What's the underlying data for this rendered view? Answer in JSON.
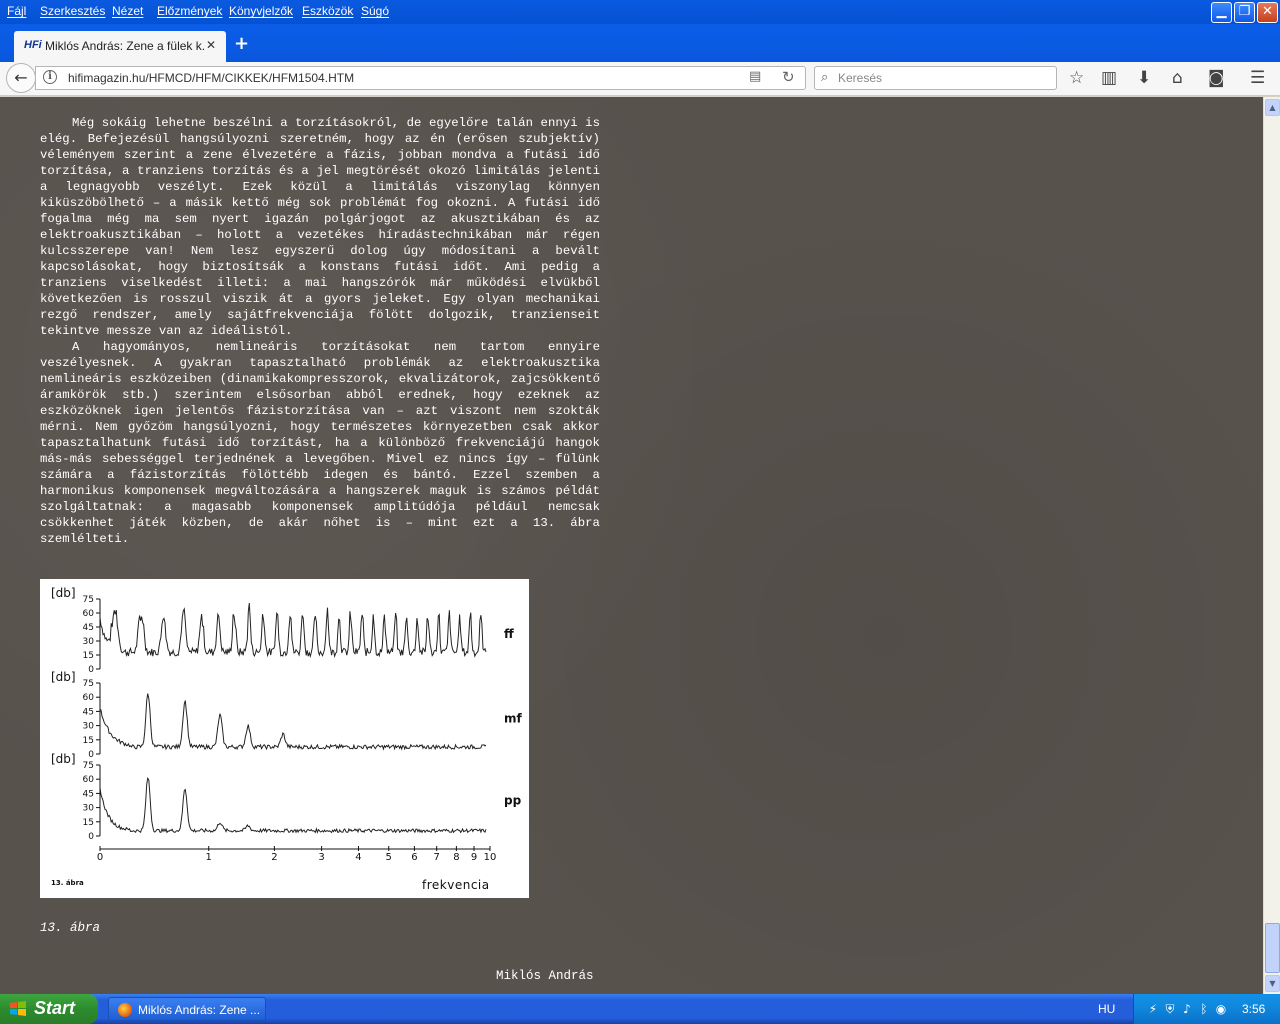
{
  "menubar": {
    "items": [
      "Fájl",
      "Szerkesztés",
      "Nézet",
      "Előzmények",
      "Könyvjelzők",
      "Eszközök",
      "Súgó"
    ]
  },
  "tab": {
    "favicon": "HFi",
    "title": "Miklós András: Zene a fülek k...",
    "close": "✕",
    "newtab": "+"
  },
  "navbar": {
    "url": "hifimagazin.hu/HFMCD/HFM/CIKKEK/HFM1504.HTM",
    "search_placeholder": "Keresés"
  },
  "article": {
    "paragraphs": [
      "Még sokáig lehetne beszélni a torzításokról, de egyelőre talán ennyi is elég. Befejezésül hangsúlyozni szeretném, hogy az én (erősen szubjektív) véleményem szerint a zene élvezetére a fázis, jobban mondva a futási idő torzítása, a tranziens torzítás és a jel megtörését okozó limitálás jelenti a legnagyobb veszélyt. Ezek közül a limitálás viszonylag könnyen kiküszöbölhető – a másik kettő még sok problémát fog okozni. A futási idő fogalma még ma sem nyert igazán polgárjogot az akusztikában és az elektroakusztikában – holott a vezetékes híradástechnikában már régen kulcsszerepe van! Nem lesz egyszerű dolog úgy módosítani a bevált kapcsolásokat, hogy biztosítsák a konstans futási időt. Ami pedig a tranziens viselkedést illeti: a mai hangszórók már működési elvükből következően is rosszul viszik át a gyors jeleket. Egy olyan mechanikai rezgő rendszer, amely sajátfrekvenciája fölött dolgozik, tranzienseit tekintve messze van az ideálistól.",
      "A hagyományos, nemlineáris torzításokat nem tartom ennyire veszélyesnek. A gyakran tapasztalható problémák az elektroakusztika nemlineáris eszközeiben (dinamikakompresszorok, ekvalizátorok, zajcsökkentő áramkörök stb.) szerintem elsősorban abból erednek, hogy ezeknek az eszközöknek igen jelentős fázistorzítása van – azt viszont nem szokták mérni. Nem győzöm hangsúlyozni, hogy természetes környezetben csak akkor tapasztalhatunk futási idő torzítást, ha a különböző frekvenciájú hangok más-más sebességgel terjednének a levegőben. Mivel ez nincs így – fülünk számára a fázistorzítás fölöttébb idegen és bántó. Ezzel szemben a harmonikus komponensek megváltozására a hangszerek maguk is számos példát szolgáltatnak: a magasabb komponensek amplitúdója például nemcsak csökkenhet játék közben, de akár nőhet is – mint ezt a 13. ábra szemlélteti."
    ],
    "figure": {
      "y_unit": "[db]",
      "y_ticks": [
        "75",
        "60",
        "45",
        "30",
        "15",
        "0"
      ],
      "x_ticks": [
        "0",
        "1",
        "2",
        "3",
        "4",
        "5",
        "6",
        "7",
        "8",
        "9",
        "10"
      ],
      "x_label": "frekvencia",
      "panel_labels": [
        "ff",
        "mf",
        "pp"
      ],
      "corner_label": "13. ábra"
    },
    "caption": "13. ábra",
    "author": "Miklós András"
  },
  "taskbar": {
    "start": "Start",
    "task_title": "Miklós András: Zene ...",
    "lang": "HU",
    "clock": "3:56"
  }
}
